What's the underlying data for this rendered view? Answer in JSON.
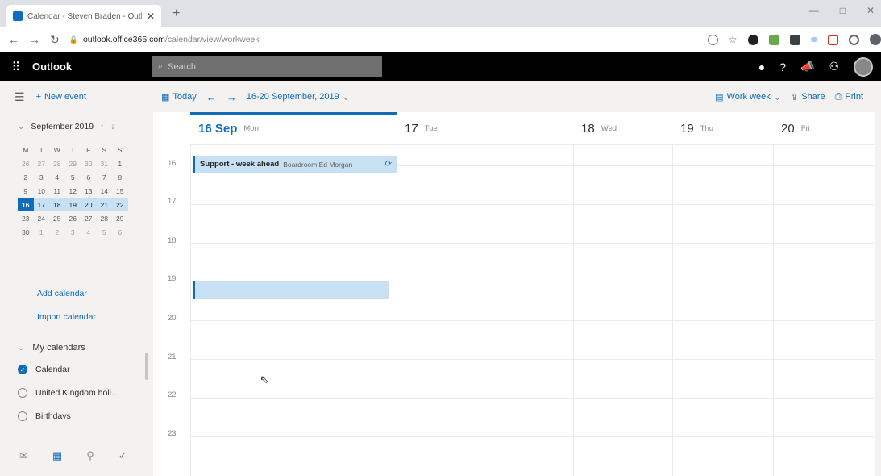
{
  "browser": {
    "tab_title": "Calendar - Steven Braden - Outl...",
    "tab_close": "✕",
    "new_tab": "+",
    "url_domain": "outlook.office365.com",
    "url_path": "/calendar/view/workweek",
    "window_controls": [
      "—",
      "□",
      "✕"
    ]
  },
  "suite": {
    "app_name": "Outlook",
    "search_placeholder": "Search"
  },
  "commands": {
    "new_event": "New event",
    "today": "Today",
    "date_range": "16-20 September, 2019",
    "view": "Work week",
    "share": "Share",
    "print": "Print"
  },
  "mini_calendar": {
    "month_label": "September 2019",
    "weekdays": [
      "M",
      "T",
      "W",
      "T",
      "F",
      "S",
      "S"
    ],
    "weeks": [
      [
        "26",
        "27",
        "28",
        "29",
        "30",
        "31",
        "1"
      ],
      [
        "2",
        "3",
        "4",
        "5",
        "6",
        "7",
        "8"
      ],
      [
        "9",
        "10",
        "11",
        "12",
        "13",
        "14",
        "15"
      ],
      [
        "16",
        "17",
        "18",
        "19",
        "20",
        "21",
        "22"
      ],
      [
        "23",
        "24",
        "25",
        "26",
        "27",
        "28",
        "29"
      ],
      [
        "30",
        "1",
        "2",
        "3",
        "4",
        "5",
        "6"
      ]
    ],
    "selected_day": "16"
  },
  "left_links": {
    "add_calendar": "Add calendar",
    "import_calendar": "Import calendar"
  },
  "my_calendars": {
    "heading": "My calendars",
    "items": [
      {
        "label": "Calendar",
        "checked": true
      },
      {
        "label": "United Kingdom holi...",
        "checked": false
      },
      {
        "label": "Birthdays",
        "checked": false
      }
    ]
  },
  "days": [
    {
      "num": "16 Sep",
      "name": "Mon"
    },
    {
      "num": "17",
      "name": "Tue"
    },
    {
      "num": "18",
      "name": "Wed"
    },
    {
      "num": "19",
      "name": "Thu"
    },
    {
      "num": "20",
      "name": "Fri"
    }
  ],
  "hours": [
    "16",
    "17",
    "18",
    "19",
    "20",
    "21",
    "22",
    "23"
  ],
  "event": {
    "title": "Support - week ahead",
    "location": "Boardroom Ed Morgan"
  },
  "colors": {
    "accent": "#0f6cbd",
    "event_fill": "#c7e0f4",
    "suite_bar": "#000000"
  }
}
